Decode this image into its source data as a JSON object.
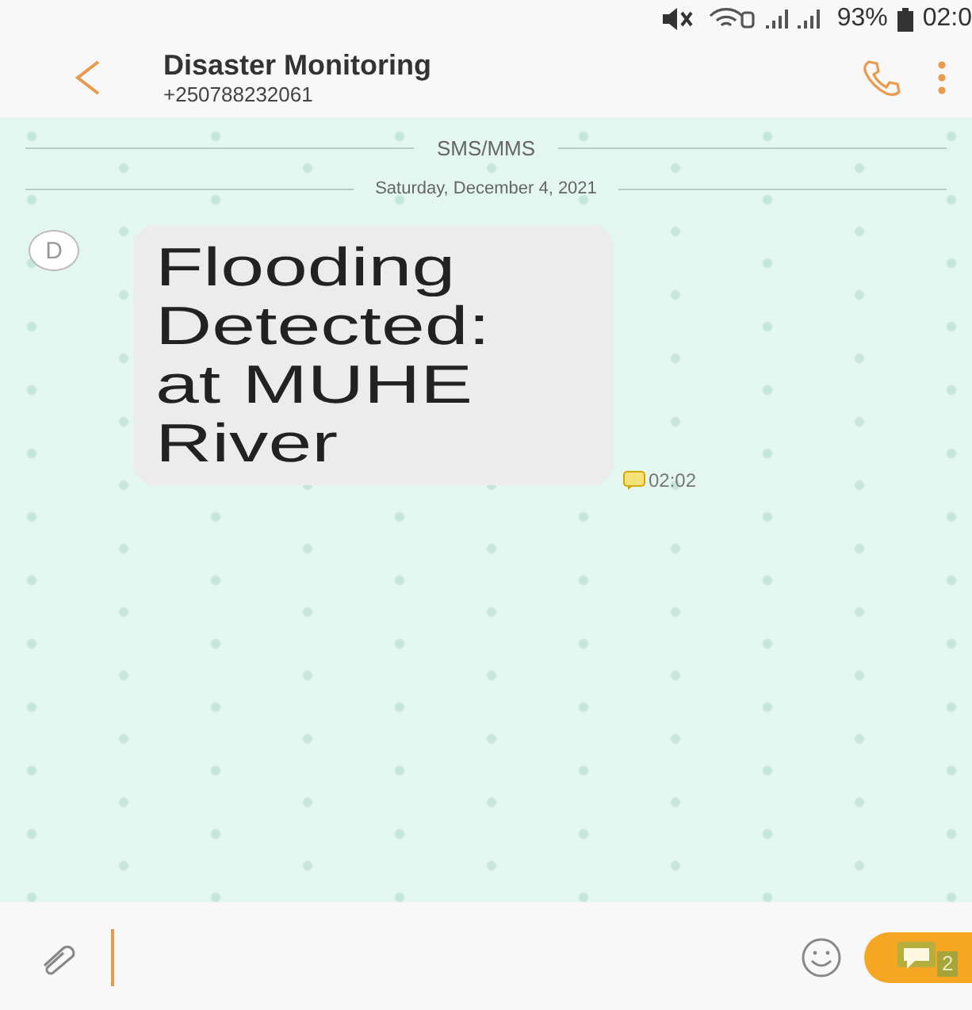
{
  "status_bar": {
    "battery": "93%",
    "time": "02:0"
  },
  "header": {
    "title": "Disaster Monitoring",
    "subtitle": "+250788232061"
  },
  "chat": {
    "channel_label": "SMS/MMS",
    "date": "Saturday, December 4, 2021",
    "messages": [
      {
        "avatar": "D",
        "text": "Flooding Detected: at MUHE River",
        "time": "02:02"
      }
    ]
  },
  "composer": {
    "send_count": "2"
  }
}
